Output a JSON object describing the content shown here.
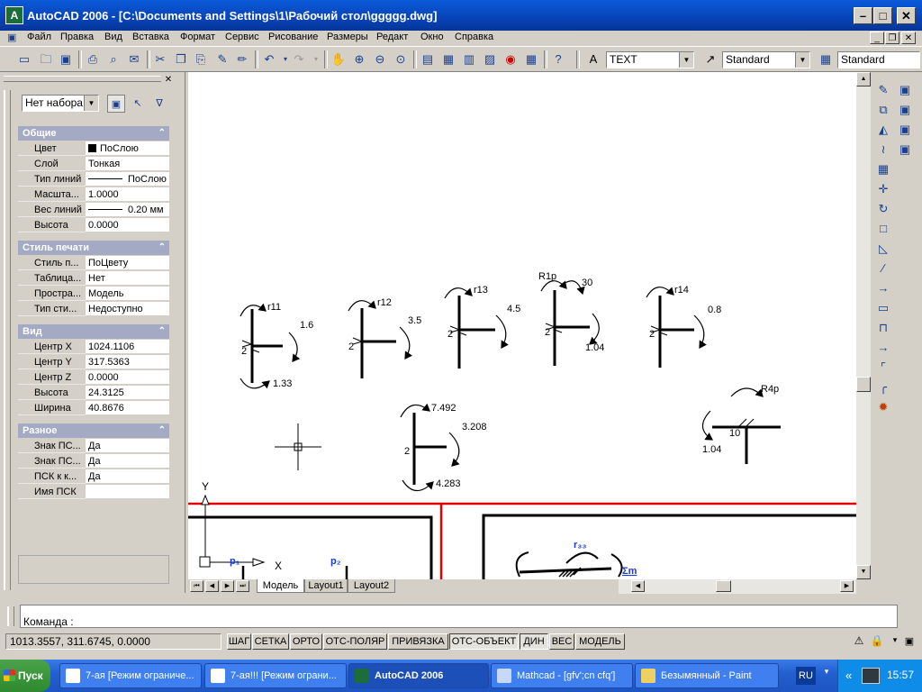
{
  "window": {
    "title": "AutoCAD 2006 - [C:\\Documents and Settings\\1\\Рабочий стол\\ggggg.dwg]",
    "icon_label": "A"
  },
  "menu": {
    "items": [
      "Файл",
      "Правка",
      "Вид",
      "Вставка",
      "Формат",
      "Сервис",
      "Рисование",
      "Размеры",
      "Редакт",
      "Окно",
      "Справка"
    ]
  },
  "toolbar": {
    "text_style": "TEXT",
    "dim_style": "Standard",
    "table_style": "Standard"
  },
  "palette": {
    "selection": "Нет набора",
    "sections": [
      {
        "title": "Общие",
        "rows": [
          {
            "label": "Цвет",
            "value": "ПоСлою"
          },
          {
            "label": "Слой",
            "value": "Тонкая"
          },
          {
            "label": "Тип линий",
            "value": "ПоСлою"
          },
          {
            "label": "Масшта...",
            "value": "1.0000"
          },
          {
            "label": "Вес линий",
            "value": "0.20 мм"
          },
          {
            "label": "Высота",
            "value": "0.0000"
          }
        ]
      },
      {
        "title": "Стиль печати",
        "rows": [
          {
            "label": "Стиль п...",
            "value": "ПоЦвету"
          },
          {
            "label": "Таблица...",
            "value": "Нет"
          },
          {
            "label": "Простра...",
            "value": "Модель"
          },
          {
            "label": "Тип сти...",
            "value": "Недоступно"
          }
        ]
      },
      {
        "title": "Вид",
        "rows": [
          {
            "label": "Центр X",
            "value": "1024.1106"
          },
          {
            "label": "Центр Y",
            "value": "317.5363"
          },
          {
            "label": "Центр Z",
            "value": "0.0000"
          },
          {
            "label": "Высота",
            "value": "24.3125"
          },
          {
            "label": "Ширина",
            "value": "40.8676"
          }
        ]
      },
      {
        "title": "Разное",
        "rows": [
          {
            "label": "Знак ПС...",
            "value": "Да"
          },
          {
            "label": "Знак ПС...",
            "value": "Да"
          },
          {
            "label": "ПСК к к...",
            "value": "Да"
          },
          {
            "label": "Имя ПСК",
            "value": ""
          }
        ]
      }
    ]
  },
  "drawing": {
    "labels": {
      "f1_r": "r11",
      "f1_a": "1.6",
      "f1_b": "1.33",
      "f1_n": "2",
      "f2_r": "r12",
      "f2_a": "3.5",
      "f2_n": "2",
      "f3_r": "r13",
      "f3_a": "4.5",
      "f3_n": "2",
      "f4_r": "R1p",
      "f4_a": "30",
      "f4_b": "1.04",
      "f4_n": "2",
      "f5_r": "r14",
      "f5_a": "0.8",
      "f5_n": "2",
      "f6_a": "7.492",
      "f6_b": "3.208",
      "f6_c": "4.283",
      "f6_n": "2",
      "f7_r": "R4p",
      "f7_b": "1.04",
      "f7_n": "10",
      "p1": "p₁",
      "p2": "p₂",
      "r_blue": "r₃₃",
      "m_blue": "Σm",
      "ucs_x": "X",
      "ucs_y": "Y"
    }
  },
  "tabs": [
    "Модель",
    "Layout1",
    "Layout2"
  ],
  "command": {
    "prompt": "Команда :"
  },
  "status": {
    "coords": "1013.3557, 311.6745, 0.0000",
    "buttons": [
      {
        "label": "ШАГ",
        "pressed": false
      },
      {
        "label": "СЕТКА",
        "pressed": false
      },
      {
        "label": "ОРТО",
        "pressed": false
      },
      {
        "label": "ОТС-ПОЛЯР",
        "pressed": false
      },
      {
        "label": "ПРИВЯЗКА",
        "pressed": false
      },
      {
        "label": "ОТС-ОБЪЕКТ",
        "pressed": true
      },
      {
        "label": "ДИН",
        "pressed": true
      },
      {
        "label": "ВЕС",
        "pressed": false
      },
      {
        "label": "МОДЕЛЬ",
        "pressed": false
      }
    ]
  },
  "taskbar": {
    "start": "Пуск",
    "tasks": [
      "7-ая [Режим ограниче...",
      "7-ая!!! [Режим ограни...",
      "AutoCAD 2006",
      "Mathcad - [gfv';cn cfq']",
      "Безымянный - Paint"
    ],
    "lang": "RU",
    "clock": "15:57"
  }
}
